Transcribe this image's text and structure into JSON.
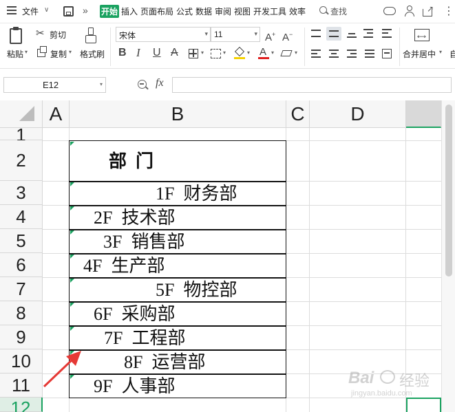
{
  "menubar": {
    "file_label": "文件",
    "tabs": [
      "开始",
      "插入",
      "页面布局",
      "公式",
      "数据",
      "审阅",
      "视图",
      "开发工具",
      "效率"
    ],
    "search_label": "查找"
  },
  "ribbon": {
    "paste_label": "粘贴",
    "cut_label": "剪切",
    "copy_label": "复制",
    "format_painter_label": "格式刷",
    "font_name": "宋体",
    "font_size": "11",
    "merge_center_label": "合并居中",
    "font_color": "#e02020",
    "highlight_color": "#f5d200"
  },
  "formula_bar": {
    "name_box": "E12",
    "fx_label": "fx",
    "content": ""
  },
  "sheet": {
    "columns": [
      "A",
      "B",
      "C",
      "D"
    ],
    "rows": [
      "1",
      "2",
      "3",
      "4",
      "5",
      "6",
      "7",
      "8",
      "9",
      "10",
      "11",
      "12"
    ],
    "header_cell": "部  门",
    "cells": [
      "1F  财务部",
      "2F  技术部",
      "3F  销售部",
      "4F  生产部",
      "5F  物控部",
      "6F  采购部",
      "7F  工程部",
      "8F  运营部",
      "9F  人事部"
    ]
  },
  "watermark": {
    "brand": "Bai",
    "site": "经验",
    "url": "jingyan.baidu.com"
  },
  "colors": {
    "accent_green": "#1aa260",
    "arrow_red": "#e53935"
  }
}
